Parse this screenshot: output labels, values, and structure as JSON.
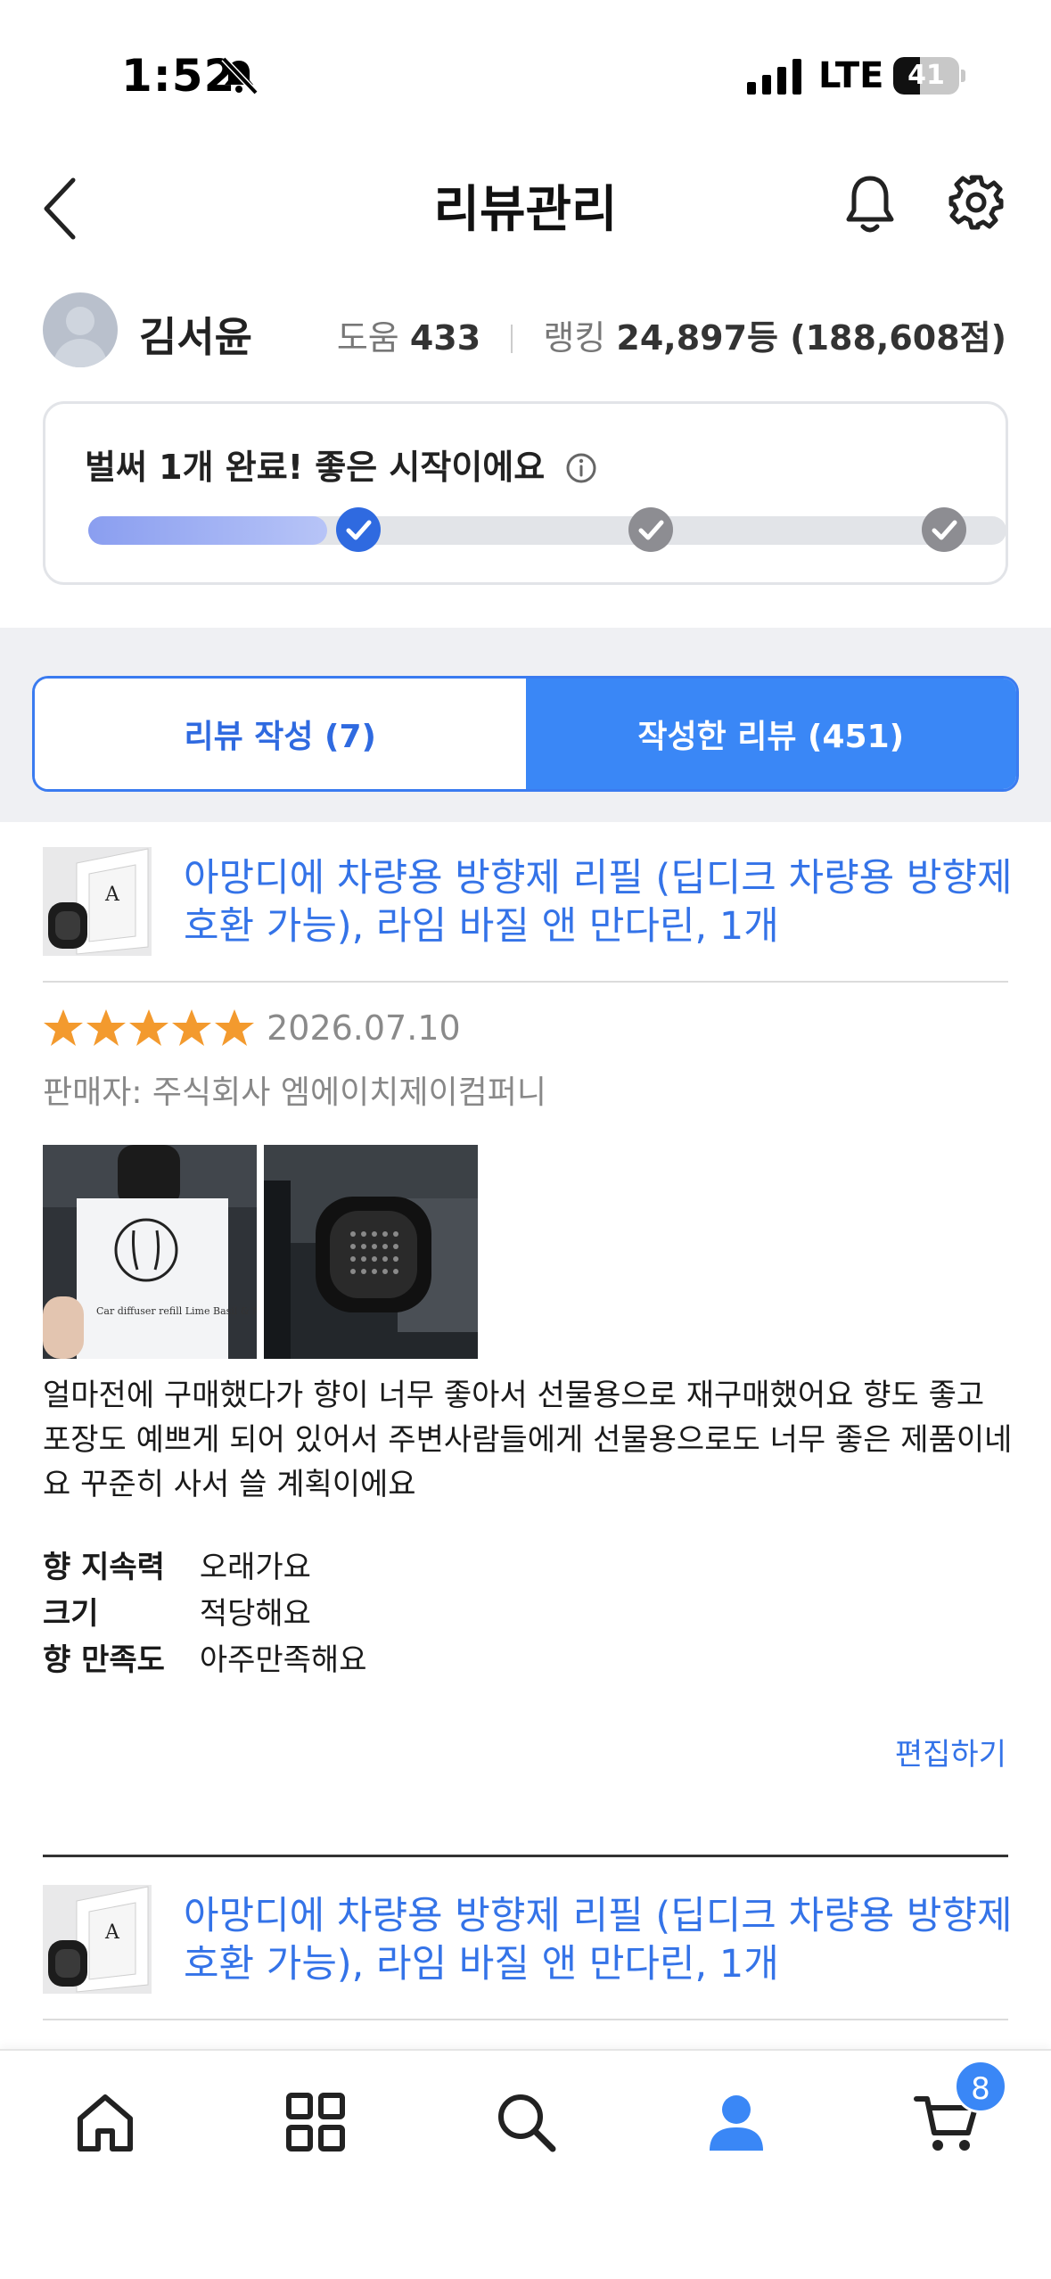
{
  "status_bar": {
    "time": "1:52",
    "network": "LTE",
    "battery_percent": "41",
    "battery_level": 0.41
  },
  "header": {
    "title": "리뷰관리"
  },
  "profile": {
    "name": "김서윤",
    "help_label": "도움",
    "help_count": "433",
    "ranking_label": "랭킹",
    "ranking_value": "24,897등 (188,608점)"
  },
  "progress": {
    "message": "벌써 1개 완료! 좋은 시작이에요",
    "completed_steps": 1,
    "total_steps": 3,
    "fill_fraction": 0.26
  },
  "tabs": [
    {
      "label": "리뷰 작성 (7)",
      "active": false
    },
    {
      "label": "작성한 리뷰 (451)",
      "active": true
    }
  ],
  "reviews": [
    {
      "product_title": "아망디에 차량용 방향제 리필 (딥디크 차량용 방향제 호환 가능), 라임 바질 앤 만다린, 1개",
      "rating": 5,
      "date": "2026.07.10",
      "seller": "판매자: 주식회사 엠에이치제이컴퍼니",
      "photo_caption": "Car diffuser refill Lime Basil & Mandarin Italy",
      "text": "얼마전에 구매했다가 향이 너무 좋아서 선물용으로 재구매했어요 향도 좋고 포장도 예쁘게 되어 있어서 주변사람들에게 선물용으로도 너무 좋은 제품이네요 꾸준히 사서 쓸 계획이에요",
      "attributes": [
        {
          "label": "향 지속력",
          "value": "오래가요"
        },
        {
          "label": "크기",
          "value": "적당해요"
        },
        {
          "label": "향 만족도",
          "value": "아주만족해요"
        }
      ],
      "edit_label": "편집하기"
    },
    {
      "product_title": "아망디에 차량용 방향제 리필 (딥디크 차량용 방향제 호환 가능), 라임 바질 앤 만다린, 1개"
    }
  ],
  "bottom_nav": {
    "items": [
      "home-icon",
      "grid-icon",
      "search-icon",
      "person-icon",
      "cart-icon"
    ],
    "active": "person-icon",
    "cart_count": "8",
    "accent_color": "#3a87f6"
  }
}
